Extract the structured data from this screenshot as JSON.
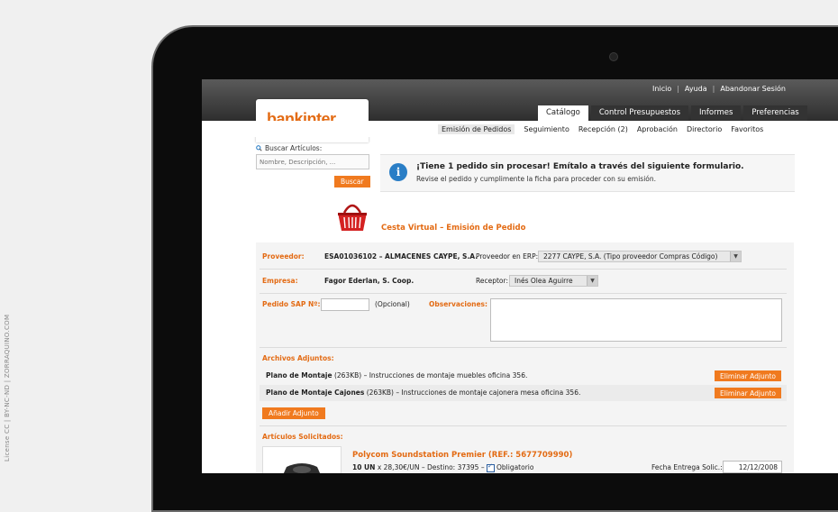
{
  "top_links": [
    "Inicio",
    "Ayuda",
    "Abandonar Sesión"
  ],
  "logo_text": "bankinter.",
  "tabs": [
    {
      "label": "Catálogo",
      "active": true
    },
    {
      "label": "Control Presupuestos",
      "active": false
    },
    {
      "label": "Informes",
      "active": false
    },
    {
      "label": "Preferencias",
      "active": false
    }
  ],
  "subnav": [
    {
      "label": "Emisión de Pedidos",
      "active": true
    },
    {
      "label": "Seguimiento",
      "active": false
    },
    {
      "label": "Recepción (2)",
      "active": false
    },
    {
      "label": "Aprobación",
      "active": false
    },
    {
      "label": "Directorio",
      "active": false
    },
    {
      "label": "Favoritos",
      "active": false
    }
  ],
  "search": {
    "label": "Buscar Artículos:",
    "placeholder": "Nombre, Descripción, ...",
    "button": "Buscar"
  },
  "notice": {
    "title": "¡Tiene 1 pedido sin procesar! Emítalo a través del siguiente formulario.",
    "subtitle": "Revise el pedido y cumplimente la ficha para proceder con su emisión."
  },
  "section_title": "Cesta Virtual – Emisión de Pedido",
  "form": {
    "proveedor_label": "Proveedor:",
    "proveedor_value": "ESA01036102 – ALMACENES CAYPE, S.A.",
    "proveedor_erp_label": "Proveedor en ERP:",
    "proveedor_erp_value": "2277 CAYPE, S.A. (Tipo proveedor Compras Código)",
    "empresa_label": "Empresa:",
    "empresa_value": "Fagor Ederlan, S. Coop.",
    "receptor_label": "Receptor:",
    "receptor_value": "Inés Olea Aguirre",
    "pedido_sap_label": "Pedido SAP Nº:",
    "pedido_sap_value": "",
    "opcional": "(Opcional)",
    "observaciones_label": "Observaciones:"
  },
  "attachments": {
    "title": "Archivos Adjuntos:",
    "items": [
      {
        "name": "Plano de Montaje",
        "size": "(263KB)",
        "desc": "– Instrucciones de montaje muebles oficina 356.",
        "button": "Eliminar Adjunto"
      },
      {
        "name": "Plano de Montaje Cajones",
        "size": "(263KB)",
        "desc": "– Instrucciones de montaje cajonera mesa oficina 356.",
        "button": "Eliminar Adjunto"
      }
    ],
    "add_button": "Añadir Adjunto"
  },
  "articles": {
    "title": "Artículos Solicitados:",
    "product_title": "Polycom Soundstation Premier (REF.: 5677709990)",
    "qty": "10 UN",
    "price_line": "x 28,30€/UN – Destino: 37395 –",
    "obligatorio": "Obligatorio",
    "fecha_label": "Fecha Entrega Solic.:",
    "fecha_value": "12/12/2008"
  },
  "side_credit": "License CC | BY-NC-ND | ZORRAQUINO.COM",
  "colors": {
    "accent": "#e36b14",
    "button": "#f07a1f",
    "info": "#2a7ec6"
  }
}
